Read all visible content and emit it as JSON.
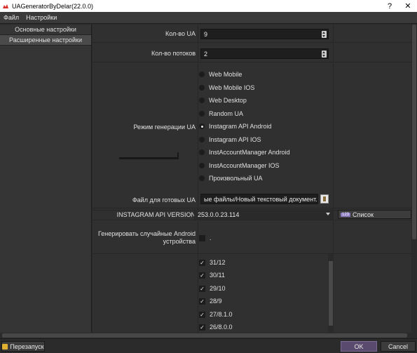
{
  "window": {
    "title": "UAGeneratorByDelar(22.0.0)",
    "help": "?",
    "close": "✕"
  },
  "menu": {
    "items": [
      "Файл",
      "Настройки"
    ]
  },
  "sidebar": {
    "items": [
      {
        "label": "Основные настройки"
      },
      {
        "label": "Расширенные настройки"
      }
    ]
  },
  "settings": {
    "ua_count": {
      "label": "Кол-во UA",
      "value": "9"
    },
    "threads": {
      "label": "Кол-во потоков",
      "value": "2"
    },
    "mode": {
      "label": "Режим генерации UA",
      "options": [
        "Web Mobile",
        "Web Mobile IOS",
        "Web Desktop",
        "Random UA",
        "Instagram API Android",
        "Instagram API IOS",
        "InstAccountManager Android",
        "InstAccountManager IOS",
        "Произвольный UA"
      ],
      "selected": "Instagram API Android"
    },
    "output_file": {
      "label": "Файл для готовых UA",
      "value": "ые файлы/Новый текстовый документ.txt"
    },
    "api_version": {
      "label": "INSTAGRAM API VERSION",
      "value": "253.0.0.23.114",
      "list_button": "Список",
      "list_icon": "123"
    },
    "random_devices": {
      "label": "Генерировать случайные Android устройства",
      "suffix": "."
    },
    "android_versions": [
      {
        "label": "31/12",
        "checked": true
      },
      {
        "label": "30/11",
        "checked": true
      },
      {
        "label": "29/10",
        "checked": true
      },
      {
        "label": "28/9",
        "checked": true
      },
      {
        "label": "27/8.1.0",
        "checked": true
      },
      {
        "label": "26/8.0.0",
        "checked": true
      }
    ]
  },
  "bottom": {
    "restart": "Перезапуск",
    "ok": "OK",
    "cancel": "Cancel"
  },
  "colors": {
    "accent": "#5a4a6e",
    "background": "#303030"
  }
}
